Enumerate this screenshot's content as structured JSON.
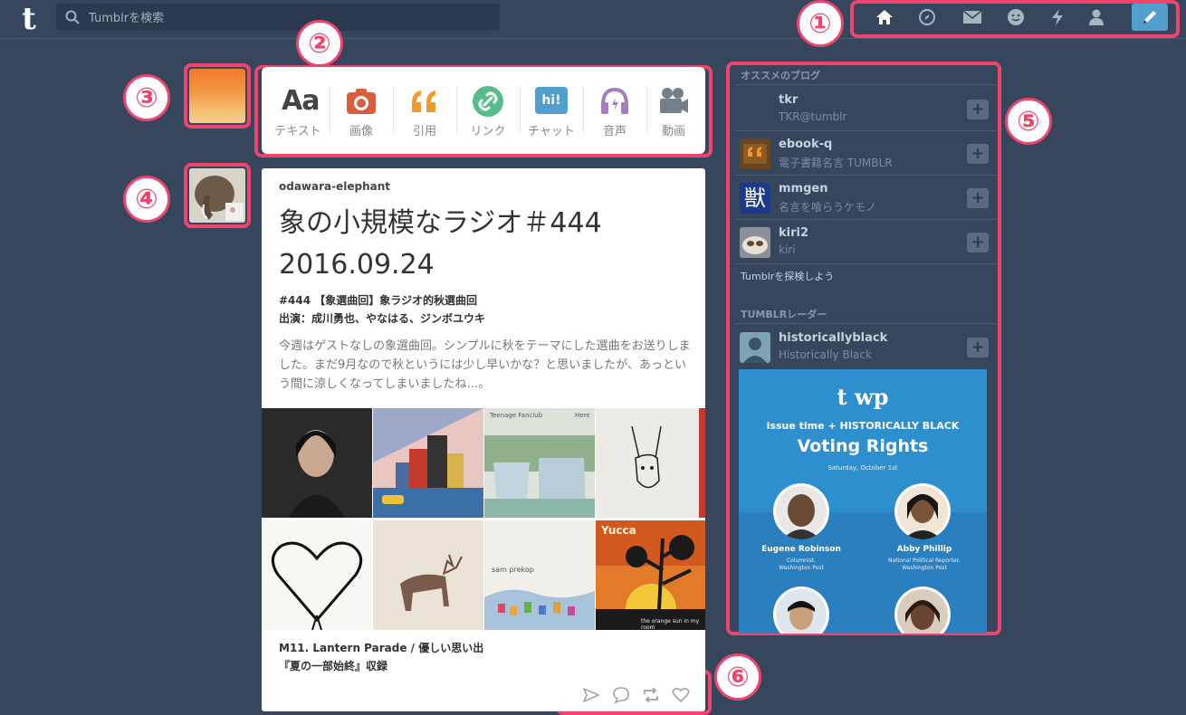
{
  "header": {
    "logo": "t",
    "search_placeholder": "Tumblrを検索",
    "nav_icons": [
      "home-icon",
      "explore-compass-icon",
      "mail-icon",
      "messaging-icon",
      "activity-bolt-icon",
      "account-person-icon"
    ],
    "compose_icon": "pencil-icon"
  },
  "badges": {
    "b1": "①",
    "b2": "②",
    "b3": "③",
    "b4": "④",
    "b5": "⑤",
    "b6": "⑥"
  },
  "postbar": {
    "items": [
      {
        "label": "テキスト",
        "icon": "text-icon",
        "glyph": "Aa",
        "color": "#444444"
      },
      {
        "label": "画像",
        "icon": "camera-icon",
        "color": "#d95e40"
      },
      {
        "label": "引用",
        "icon": "quote-icon",
        "glyph": "66",
        "color": "#f2992e"
      },
      {
        "label": "リンク",
        "icon": "link-icon",
        "color": "#56bc8a"
      },
      {
        "label": "チャット",
        "icon": "chat-icon",
        "glyph": "hi!",
        "color": "#529ecc"
      },
      {
        "label": "音声",
        "icon": "headphones-icon",
        "color": "#a77dc2"
      },
      {
        "label": "動画",
        "icon": "video-camera-icon",
        "color": "#748089"
      }
    ]
  },
  "post": {
    "author": "odawara-elephant",
    "title_line1": "象の小規模なラジオ＃444",
    "title_line2": "2016.09.24",
    "meta_line1": "#444 【象選曲回】象ラジオ的秋選曲回",
    "meta_line2": "出演：成川勇也、やなはる、ジンボユウキ",
    "body": "今週はゲストなしの象選曲回。シンプルに秋をテーマにした選曲をお送りしました。まだ9月なので秋というには少し早いかな？と思いましたが、あっという間に涼しくなってしまいましたね…。",
    "caption_line1": "M11. Lantern Parade / 優しい思い出",
    "caption_line2": "『夏の一部始終』収録",
    "actions": [
      "share-icon",
      "reply-icon",
      "reblog-icon",
      "like-heart-icon"
    ],
    "album_text": {
      "a3": "Teenage Fanclub",
      "a3b": "Here",
      "a7": "sam prekop",
      "a8": "Yucca",
      "a8b": "the orange sun in my room"
    }
  },
  "sidebar": {
    "recommended_heading": "オススメのブログ",
    "blogs": [
      {
        "name": "tkr",
        "sub": "TKR@tumblr"
      },
      {
        "name": "ebook-q",
        "sub": "電子書籍名言 TUMBLR"
      },
      {
        "name": "mmgen",
        "sub": "名言を喰らうケモノ",
        "glyph": "獣"
      },
      {
        "name": "kiri2",
        "sub": "kiri"
      }
    ],
    "explore_link": "Tumblrを探検しよう",
    "radar_heading": "TUMBLRレーダー",
    "radar_blog": {
      "name": "historicallyblack",
      "sub": "Historically Black"
    },
    "plus": "+",
    "ad": {
      "logo": "t wp",
      "line1": "issue time + HISTORICALLY BLACK",
      "title": "Voting Rights",
      "date": "Saturday, October 1st",
      "p1_name": "Eugene Robinson",
      "p1_role1": "Columnist,",
      "p1_role2": "Washington Post",
      "p2_name": "Abby Phillip",
      "p2_role1": "National Political Reporter,",
      "p2_role2": "Washington Post"
    }
  }
}
